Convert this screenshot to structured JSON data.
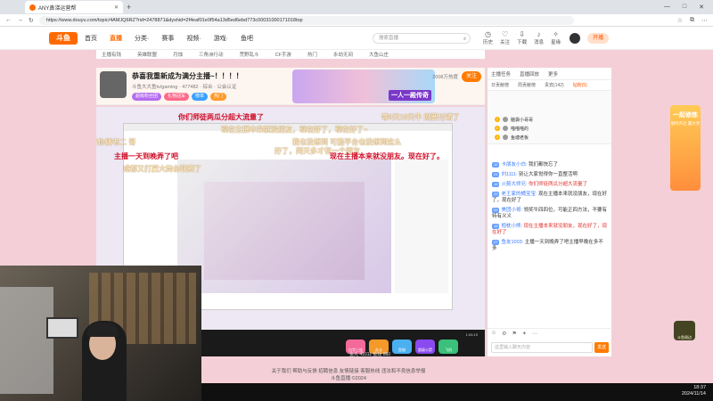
{
  "browser": {
    "tab_title": "ANY鼻涕运营帮",
    "url": "https://www.douyu.com/topic/4AMJQ6RZ?rid=2478871&dyshid=2f4eaf01e0f54a13d5ed6ebd773c00031000171018top",
    "new_tab": "+",
    "window_controls": [
      "—",
      "□",
      "✕"
    ]
  },
  "site": {
    "logo": "斗鱼",
    "nav": [
      "首页",
      "直播",
      "分类·",
      "赛事",
      "视频·",
      "游戏·",
      "鱼吧"
    ],
    "search_placeholder": "搜索直播",
    "header_icons": [
      "历史",
      "关注",
      "下载",
      "消息",
      "星缘"
    ],
    "kaibo_label": "开播"
  },
  "subnav": [
    "主播有钱",
    "英雄联盟",
    "月蚀",
    "三角洲行动",
    "荒野乱斗",
    "CF手游",
    "热门",
    "永劫无间",
    "大鱼山庄"
  ],
  "room": {
    "title": "恭喜我重新成为满分主播~！！！！",
    "meta": "斗鱼大大鱼tv/gaming · 477482 · 综合 · 公会认证",
    "badges": [
      "超级粉丝团",
      "礼物冠军",
      "榜单",
      "热门"
    ],
    "fans_text": "2008万热度",
    "follow_label": "关注",
    "banner_text": "一人一殿传奇"
  },
  "danmu": [
    {
      "text": "你们师徒两瓜分超大流量了",
      "cls": "dm-red"
    },
    {
      "text": "等9天10天牛 刚要付诸了",
      "cls": "dm-light"
    },
    {
      "text": "现在主播本来就没朋友，现在好了，现在好了~",
      "cls": "dm-light"
    },
    {
      "text": "当你俩老二 哥",
      "cls": "dm-light"
    },
    {
      "text": "我也没想到 可能平台也没想到这么",
      "cls": "dm-light"
    },
    {
      "text": "好了，两天多才有一个朋友",
      "cls": "dm-light"
    },
    {
      "text": "主播一天到晚弄了吧",
      "cls": "dm-red"
    },
    {
      "text": "现在主播本来就没朋友。现在好了。",
      "cls": "dm-red"
    },
    {
      "text": "成都又打赢大舞台联赛了",
      "cls": "dm-light"
    }
  ],
  "video": {
    "time": "1:04:19",
    "coins": "鱼丸 41011   鱼翅 880"
  },
  "gifts": [
    "白字三连",
    "办卡",
    "鱼翅",
    "超级火箭",
    "飞机"
  ],
  "footer": {
    "line1": "关于我们  帮助与反馈  招聘信息  友情链接  客服热线  违法和不良信息举报",
    "line2": "斗鱼直播   ©2024"
  },
  "chat": {
    "top": [
      "主播任务",
      "直播回放",
      "更多"
    ],
    "tabs": [
      "日贡献榜",
      "周贡献榜",
      "贵宾(142)",
      "钻粉(5)"
    ],
    "rank": [
      {
        "n": "1",
        "name": "脑袋小哥哥"
      },
      {
        "n": "2",
        "name": "喵喵喵的"
      },
      {
        "n": "3",
        "name": "鱼塘老板"
      }
    ],
    "messages": [
      {
        "lv": "12",
        "user": "卡朋友小白:",
        "text": "我们都快忘了",
        "red": false
      },
      {
        "lv": "21",
        "user": "刘1111:",
        "text": "别让大家觉得你一直整活啊",
        "red": false
      },
      {
        "lv": "15",
        "user": "火箭大师兄:",
        "text": "你们师徒两瓜分超大流量了",
        "red": true
      },
      {
        "lv": "33",
        "user": "老王家的桶宝宝:",
        "text": "现在主播本来就没朋友，现在好了，现在好了",
        "red": false
      },
      {
        "lv": "09",
        "user": "美团小哥:",
        "text": "领奖牛四四位，可能正四方法，不要有特有义义",
        "red": false
      },
      {
        "lv": "18",
        "user": "抱枕小熊:",
        "text": "现在主播本来就没朋友，现在好了，现在好了",
        "red": true
      },
      {
        "lv": "27",
        "user": "鱼友1003:",
        "text": "主播一天到晚弄了吧主播早晚在多不多",
        "red": false
      }
    ],
    "input_placeholder": "这里输入聊天内容",
    "send_label": "发送",
    "tools": [
      "☺",
      "⚙",
      "⚑",
      "✦",
      "⋯"
    ]
  },
  "side_banner": {
    "title": "一起修炼",
    "sub": "限时开启\n赢大奖"
  },
  "side_icon_label": "斗鱼周边",
  "clock": {
    "time": "18:37",
    "date": "2024/11/14"
  }
}
